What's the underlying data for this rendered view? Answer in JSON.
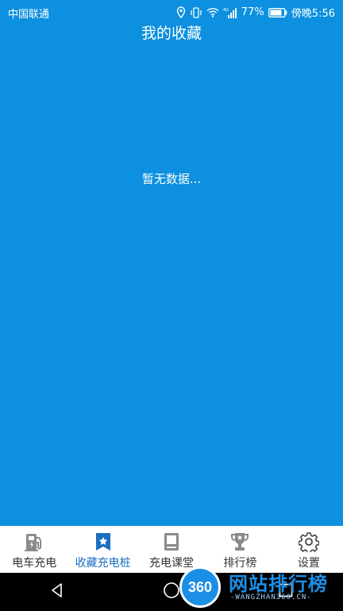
{
  "status_bar": {
    "carrier": "中国联通",
    "battery": "77%",
    "time": "傍晚5:56",
    "network": "4G"
  },
  "header": {
    "title": "我的收藏"
  },
  "main": {
    "empty_text": "暂无数据..."
  },
  "tabs": [
    {
      "label": "电车充电",
      "icon": "charging-pump-icon",
      "active": false
    },
    {
      "label": "收藏充电桩",
      "icon": "bookmark-star-icon",
      "active": true
    },
    {
      "label": "充电课堂",
      "icon": "book-icon",
      "active": false
    },
    {
      "label": "排行榜",
      "icon": "trophy-icon",
      "active": false
    },
    {
      "label": "设置",
      "icon": "gear-icon",
      "active": false
    }
  ],
  "watermark": {
    "logo_text": "360",
    "title": "网站排行榜",
    "subtitle": "-WANGZHAN360.CN-"
  },
  "colors": {
    "background": "#0c90df",
    "active_tab": "#1a6fc0",
    "inactive_icon": "#8a8a8a"
  }
}
